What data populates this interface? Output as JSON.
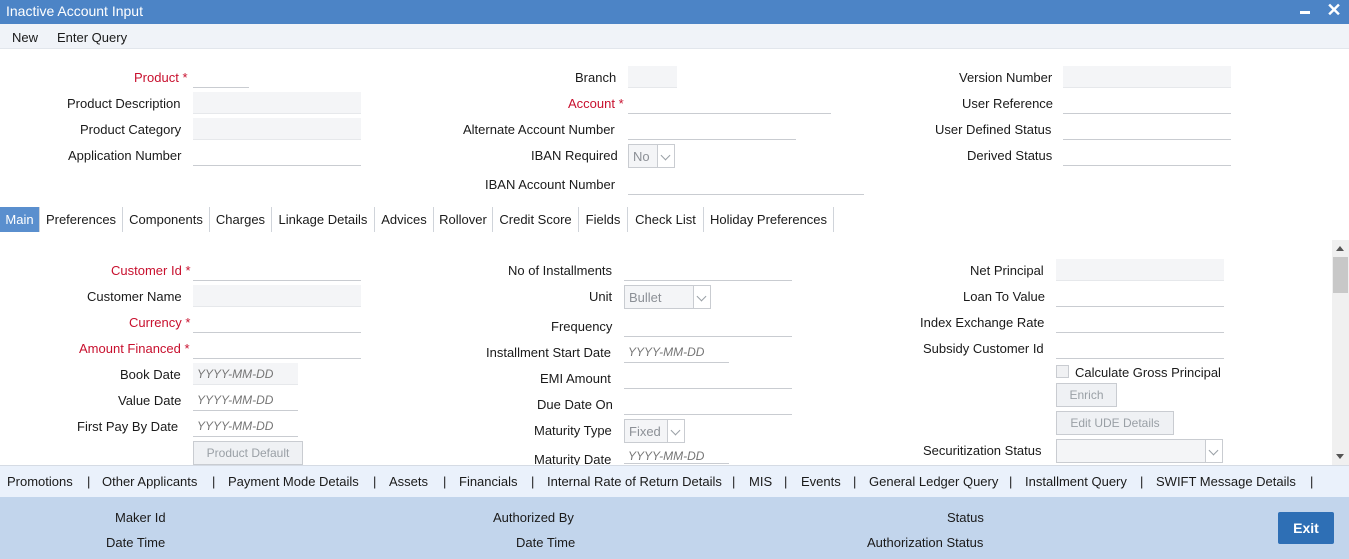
{
  "window": {
    "title": "Inactive Account Input"
  },
  "menu": {
    "new": "New",
    "enter_query": "Enter Query"
  },
  "header": {
    "product_label": "Product",
    "product_description_label": "Product Description",
    "product_category_label": "Product Category",
    "application_number_label": "Application Number",
    "branch_label": "Branch",
    "account_label": "Account",
    "alternate_account_label": "Alternate Account Number",
    "iban_required_label": "IBAN Required",
    "iban_required_value": "No",
    "iban_account_label": "IBAN Account Number",
    "version_number_label": "Version Number",
    "user_reference_label": "User Reference",
    "user_defined_status_label": "User Defined Status",
    "derived_status_label": "Derived Status",
    "required_mark": "*"
  },
  "tabs": [
    {
      "label": "Main"
    },
    {
      "label": "Preferences"
    },
    {
      "label": "Components"
    },
    {
      "label": "Charges"
    },
    {
      "label": "Linkage Details"
    },
    {
      "label": "Advices"
    },
    {
      "label": "Rollover"
    },
    {
      "label": "Credit Score"
    },
    {
      "label": "Fields"
    },
    {
      "label": "Check List"
    },
    {
      "label": "Holiday Preferences"
    }
  ],
  "main": {
    "customer_id_label": "Customer Id",
    "customer_name_label": "Customer Name",
    "currency_label": "Currency",
    "amount_financed_label": "Amount Financed",
    "book_date_label": "Book Date",
    "value_date_label": "Value Date",
    "first_pay_by_date_label": "First Pay By Date",
    "date_placeholder": "YYYY-MM-DD",
    "product_default_button": "Product Default",
    "no_of_installments_label": "No of Installments",
    "unit_label": "Unit",
    "unit_value": "Bullet",
    "frequency_label": "Frequency",
    "installment_start_date_label": "Installment Start Date",
    "emi_amount_label": "EMI Amount",
    "due_date_on_label": "Due Date On",
    "maturity_type_label": "Maturity Type",
    "maturity_type_value": "Fixed",
    "maturity_date_label": "Maturity Date",
    "net_principal_label": "Net Principal",
    "loan_to_value_label": "Loan To Value",
    "index_exchange_rate_label": "Index Exchange Rate",
    "subsidy_customer_id_label": "Subsidy Customer Id",
    "calculate_gross_principal_label": "Calculate Gross Principal",
    "enrich_button": "Enrich",
    "edit_ude_details_button": "Edit UDE Details",
    "securitization_status_label": "Securitization Status"
  },
  "links": [
    "Promotions",
    "Other Applicants",
    "Payment Mode Details",
    "Assets",
    "Financials",
    "Internal Rate of Return Details",
    "MIS",
    "Events",
    "General Ledger Query",
    "Installment Query",
    "SWIFT Message Details"
  ],
  "link_separator": "|",
  "footer": {
    "maker_id_label": "Maker Id",
    "date_time_label": "Date Time",
    "authorized_by_label": "Authorized By",
    "status_label": "Status",
    "authorization_status_label": "Authorization Status",
    "exit_button": "Exit"
  },
  "colors": {
    "title_bar": "#4c84c6",
    "required_label": "#c8102e",
    "active_tab": "#5a8fce",
    "footer": "#c2d5ec",
    "exit_button": "#2e6fb5"
  }
}
